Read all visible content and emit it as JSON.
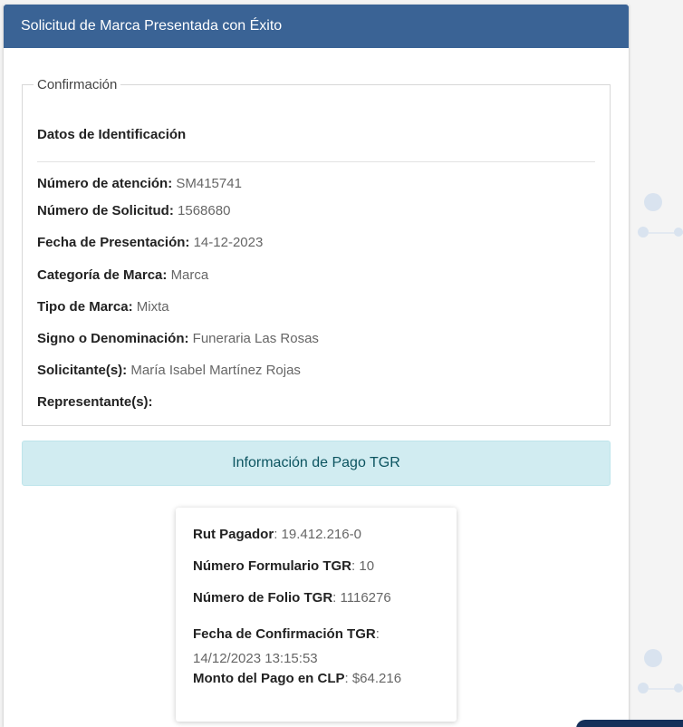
{
  "header": {
    "title": "Solicitud de Marca Presentada con Éxito"
  },
  "confirmation": {
    "legend": "Confirmación",
    "section_title": "Datos de Identificación",
    "fields": [
      {
        "label": "Número de atención:",
        "value": "SM415741"
      },
      {
        "label": "Número de Solicitud:",
        "value": "1568680"
      },
      {
        "label": "Fecha de Presentación:",
        "value": "14-12-2023"
      },
      {
        "label": "Categoría de Marca:",
        "value": "Marca"
      },
      {
        "label": "Tipo de Marca:",
        "value": "Mixta"
      },
      {
        "label": "Signo o Denominación:",
        "value": "Funeraria Las Rosas"
      },
      {
        "label": "Solicitante(s):",
        "value": "María Isabel Martínez Rojas"
      },
      {
        "label": "Representante(s):",
        "value": ""
      }
    ]
  },
  "payment": {
    "banner": "Información de Pago TGR",
    "fields": [
      {
        "label": "Rut Pagador",
        "value": "19.412.216-0"
      },
      {
        "label": "Número Formulario TGR",
        "value": "10"
      },
      {
        "label": "Número de Folio TGR",
        "value": "1116276"
      },
      {
        "label": "Fecha de Confirmación TGR",
        "value": "14/12/2023 13:15:53"
      },
      {
        "label": "Monto del Pago en CLP",
        "value": "$64.216"
      }
    ]
  },
  "colors": {
    "header_bg": "#3a6395",
    "info_bg": "#d1ecf1",
    "info_text": "#0c5460"
  }
}
